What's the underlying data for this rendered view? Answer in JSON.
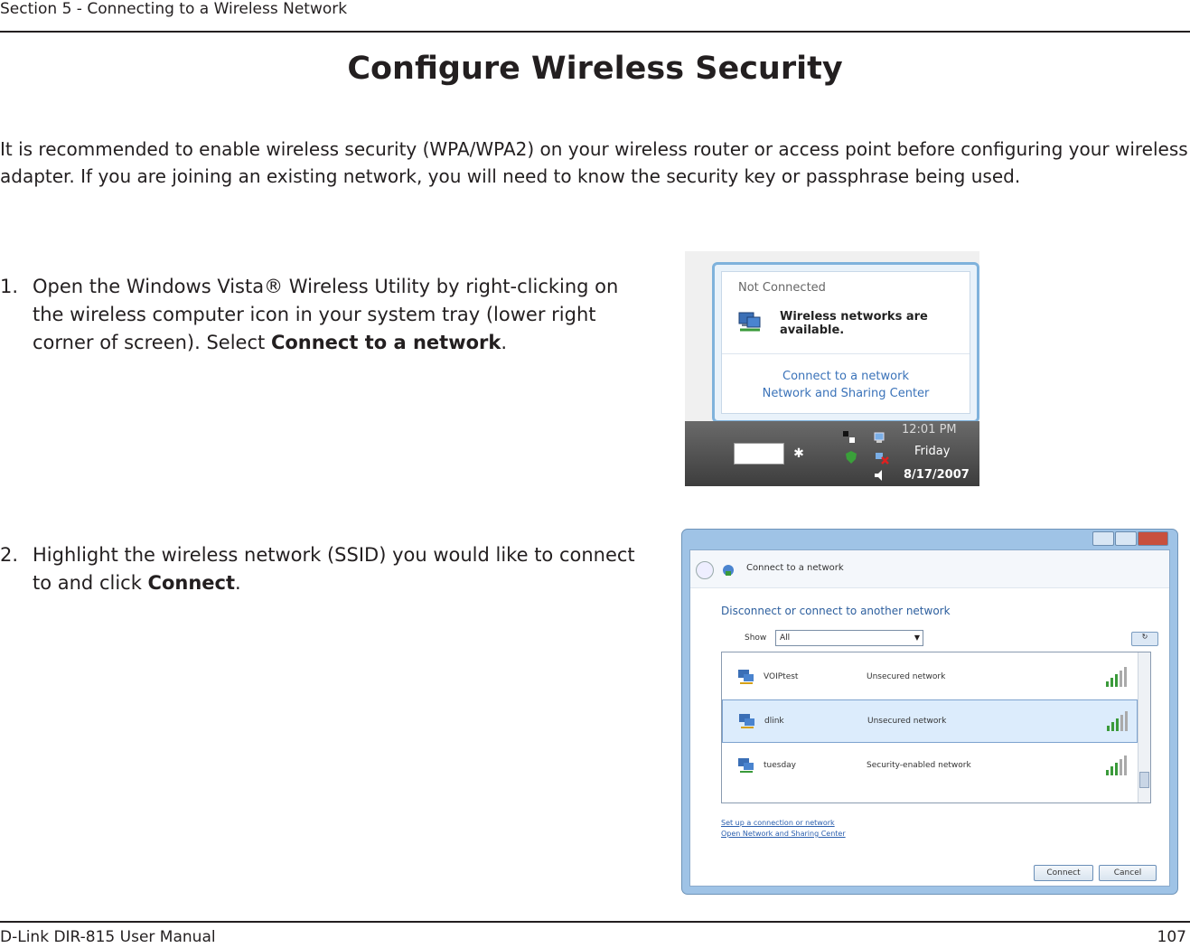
{
  "header": {
    "section": "Section 5 - Connecting to a Wireless Network"
  },
  "title": "Configure Wireless Security",
  "intro": "It is recommended to enable wireless security (WPA/WPA2) on your wireless router or access point before configuring your wireless adapter. If you are joining an existing network, you will need to know the security key or passphrase being used.",
  "steps": [
    {
      "number": "1.",
      "before": "Open the Windows Vista® Wireless Utility by right-clicking on the wireless computer icon in your system tray (lower right corner of screen). Select ",
      "bold": "Connect to a network",
      "after": "."
    },
    {
      "number": "2.",
      "before": "Highlight the wireless network (SSID) you would like to connect to and click ",
      "bold": "Connect",
      "after": "."
    }
  ],
  "screenshot1": {
    "status": "Not Connected",
    "message": "Wireless networks are available.",
    "link1": "Connect to a network",
    "link2": "Network and Sharing Center",
    "time": "12:01 PM",
    "day": "Friday",
    "date": "8/17/2007"
  },
  "screenshot2": {
    "title": "Connect to a network",
    "subtitle": "Disconnect or connect to another network",
    "show_label": "Show",
    "show_value": "All",
    "networks": [
      {
        "name": "VOIPtest",
        "security": "Unsecured network"
      },
      {
        "name": "dlink",
        "security": "Unsecured network"
      },
      {
        "name": "tuesday",
        "security": "Security-enabled network"
      }
    ],
    "link_setup": "Set up a connection or network",
    "link_center": "Open Network and Sharing Center",
    "connect": "Connect",
    "cancel": "Cancel"
  },
  "footer": {
    "left": "D-Link DIR-815 User Manual",
    "page": "107"
  },
  "colors": {
    "text": "#231f20",
    "link": "#3b73b9",
    "selected_row": "#dcecfc"
  }
}
